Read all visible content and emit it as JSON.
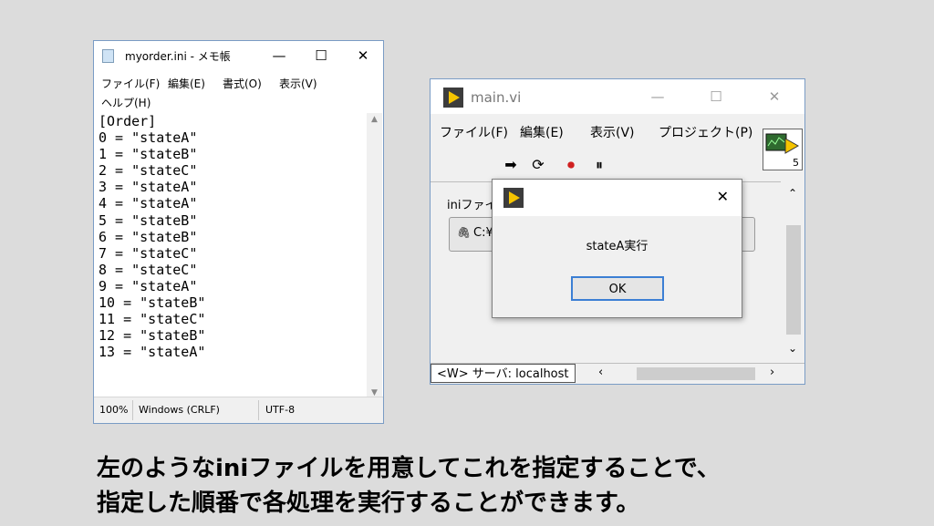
{
  "notepad": {
    "title": "myorder.ini - メモ帳",
    "controls": {
      "minimize": "—",
      "maximize": "☐",
      "close": "✕"
    },
    "menu": [
      "ファイル(F)",
      "編集(E)",
      "書式(O)",
      "表示(V)",
      "ヘルプ(H)"
    ],
    "lines": [
      "[Order]",
      "0 = \"stateA\"",
      "1 = \"stateB\"",
      "2 = \"stateC\"",
      "3 = \"stateA\"",
      "4 = \"stateA\"",
      "5 = \"stateB\"",
      "6 = \"stateB\"",
      "7 = \"stateC\"",
      "8 = \"stateC\"",
      "9 = \"stateA\"",
      "10 = \"stateB\"",
      "11 = \"stateC\"",
      "12 = \"stateB\"",
      "13 = \"stateA\""
    ],
    "status": {
      "zoom": "100%",
      "line_ending": "Windows (CRLF)",
      "encoding": "UTF-8"
    }
  },
  "mainvi": {
    "title": "main.vi",
    "controls": {
      "minimize": "—",
      "maximize": "☐",
      "close": "✕"
    },
    "menu": [
      "ファイル(F)",
      "編集(E)",
      "表示(V)",
      "プロジェクト(P)"
    ],
    "vi_icon_number": "5",
    "control_label": "iniファイ",
    "path_value": "C:¥",
    "server": "<W> サーバ: localhost"
  },
  "dialog": {
    "message": "stateA実行",
    "ok_label": "OK",
    "close": "✕"
  },
  "caption": {
    "line1": "左のようなiniファイルを用意してこれを指定することで、",
    "line2": "指定した順番で各処理を実行することができます。"
  }
}
